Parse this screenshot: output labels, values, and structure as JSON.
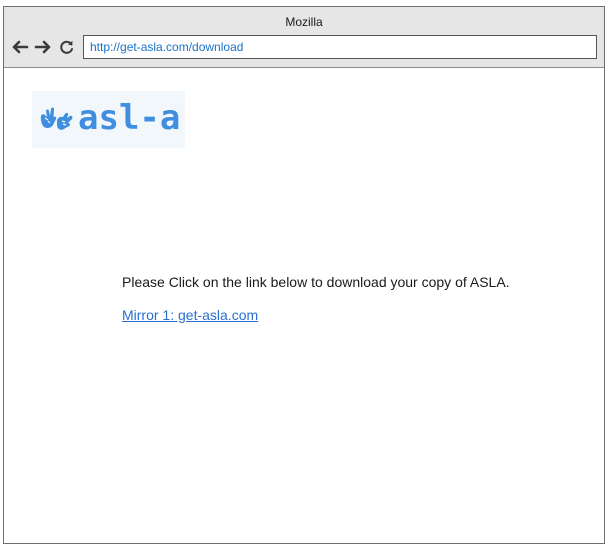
{
  "browser": {
    "title": "Mozilla",
    "url": "http://get-asla.com/download",
    "icons": {
      "back": "arrow-left-icon",
      "forward": "arrow-right-icon",
      "reload": "reload-icon"
    }
  },
  "page": {
    "logo": {
      "text": "asl-a",
      "icon": "signing-hands-icon",
      "color": "#3f8ee0"
    },
    "message": "Please Click on the link below to download your copy of ASLA.",
    "mirror_link": "Mirror 1: get-asla.com",
    "link_color": "#2a6fd0"
  }
}
